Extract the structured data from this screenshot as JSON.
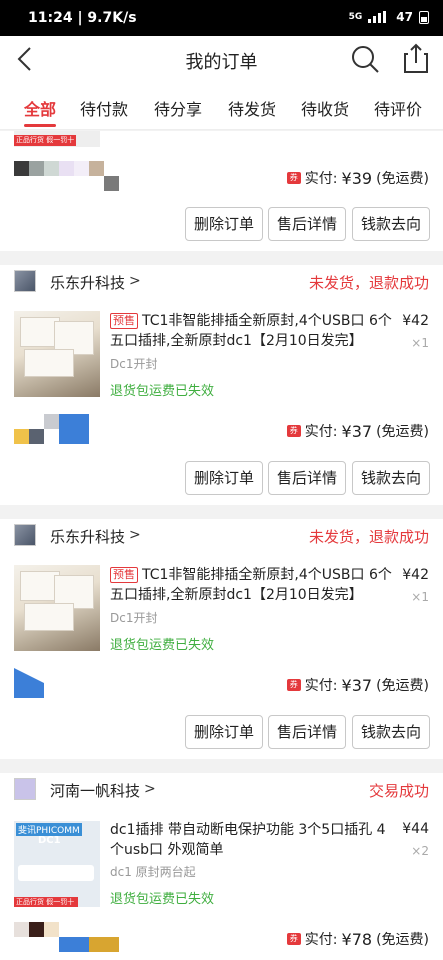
{
  "statusbar": {
    "time": "11:24 | 9.7K/s",
    "network": "5G",
    "battery": "47"
  },
  "header": {
    "title": "我的订单"
  },
  "tabs": [
    "全部",
    "待付款",
    "待分享",
    "待发货",
    "待收货",
    "待评价"
  ],
  "order0": {
    "paid_label": "实付: ",
    "paid_amount": "¥39",
    "paid_note": "(免运费)",
    "badge": "正品行货 假一罚十"
  },
  "actions": {
    "delete": "删除订单",
    "aftersale": "售后详情",
    "money": "钱款去向"
  },
  "order1": {
    "shop": "乐东升科技",
    "status": "未发货，退款成功",
    "tag": "预售",
    "product": "TC1非智能排插全新原封,4个USB口 6个五口插排,全新原封dc1【2月10日发完】",
    "spec": "Dc1开封",
    "refund_note": "退货包运费已失效",
    "price": "¥42",
    "qty": "×1",
    "paid_label": "实付: ",
    "paid_amount": "¥37",
    "paid_note": "(免运费)"
  },
  "order2": {
    "shop": "乐东升科技",
    "status": "未发货，退款成功",
    "tag": "预售",
    "product": "TC1非智能排插全新原封,4个USB口 6个五口插排,全新原封dc1【2月10日发完】",
    "spec": "Dc1开封",
    "refund_note": "退货包运费已失效",
    "price": "¥42",
    "qty": "×1",
    "paid_label": "实付: ",
    "paid_amount": "¥37",
    "paid_note": "(免运费)"
  },
  "order3": {
    "shop": "河南一帆科技",
    "status": "交易成功",
    "product": "dc1插排 带自动断电保护功能  3个5口插孔 4个usb口   外观简单",
    "spec": "dc1 原封两台起",
    "refund_note": "退货包运费已失效",
    "price": "¥44",
    "qty": "×2",
    "paid_label": "实付: ",
    "paid_amount": "¥78",
    "paid_note": "(免运费)",
    "thumb_brand": "斐讯PHICOMM",
    "thumb_model": "DC1",
    "thumb_badge": "正品行货 假一罚十"
  },
  "colors": {
    "accent": "#e4393c",
    "green": "#3fae3f"
  }
}
